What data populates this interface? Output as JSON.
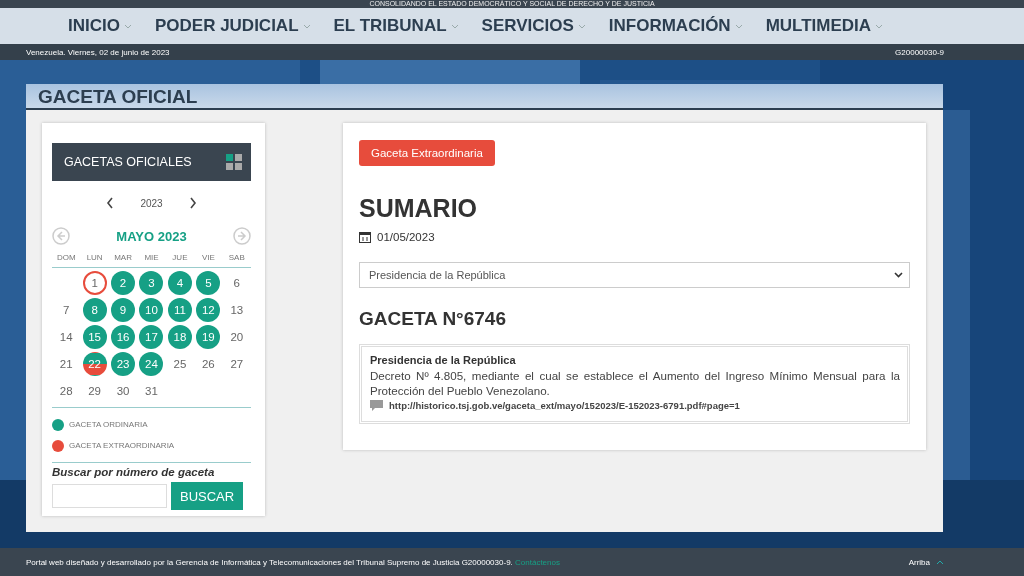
{
  "banner": {
    "text": "CONSOLIDANDO EL ESTADO DEMOCRÁTICO Y SOCIAL DE DERECHO Y DE JUSTICIA"
  },
  "nav": [
    {
      "label": "INICIO"
    },
    {
      "label": "PODER JUDICIAL"
    },
    {
      "label": "EL TRIBUNAL"
    },
    {
      "label": "SERVICIOS"
    },
    {
      "label": "INFORMACIÓN"
    },
    {
      "label": "MULTIMEDIA"
    }
  ],
  "info_bar": {
    "date": "Venezuela. Viernes, 02 de junio de 2023",
    "code": "G20000030-9"
  },
  "page_title": "GACETA OFICIAL",
  "sidebar": {
    "title": "GACETAS OFICIALES",
    "year": "2023",
    "month": "MAYO 2023",
    "weekdays": [
      "DOM",
      "LUN",
      "MAR",
      "MIE",
      "JUE",
      "VIE",
      "SAB"
    ],
    "days": [
      {
        "kind": "blank"
      },
      {
        "label": "1",
        "kind": "plain",
        "selected": true
      },
      {
        "label": "2",
        "kind": "ordinaria",
        "selected": false
      },
      {
        "label": "3",
        "kind": "ordinaria",
        "selected": false
      },
      {
        "label": "4",
        "kind": "ordinaria",
        "selected": false
      },
      {
        "label": "5",
        "kind": "ordinaria",
        "selected": false
      },
      {
        "label": "6",
        "kind": "plain",
        "selected": false
      },
      {
        "label": "7",
        "kind": "plain",
        "selected": false
      },
      {
        "label": "8",
        "kind": "ordinaria",
        "selected": false
      },
      {
        "label": "9",
        "kind": "ordinaria",
        "selected": false
      },
      {
        "label": "10",
        "kind": "ordinaria",
        "selected": false
      },
      {
        "label": "11",
        "kind": "ordinaria",
        "selected": false
      },
      {
        "label": "12",
        "kind": "ordinaria",
        "selected": false
      },
      {
        "label": "13",
        "kind": "plain",
        "selected": false
      },
      {
        "label": "14",
        "kind": "plain",
        "selected": false
      },
      {
        "label": "15",
        "kind": "ordinaria",
        "selected": false
      },
      {
        "label": "16",
        "kind": "ordinaria",
        "selected": false
      },
      {
        "label": "17",
        "kind": "ordinaria",
        "selected": false
      },
      {
        "label": "18",
        "kind": "ordinaria",
        "selected": false
      },
      {
        "label": "19",
        "kind": "ordinaria",
        "selected": false
      },
      {
        "label": "20",
        "kind": "plain",
        "selected": false
      },
      {
        "label": "21",
        "kind": "plain",
        "selected": false
      },
      {
        "label": "22",
        "kind": "mixta",
        "selected": false
      },
      {
        "label": "23",
        "kind": "ordinaria",
        "selected": false
      },
      {
        "label": "24",
        "kind": "ordinaria",
        "selected": false
      },
      {
        "label": "25",
        "kind": "plain",
        "selected": false
      },
      {
        "label": "26",
        "kind": "plain",
        "selected": false
      },
      {
        "label": "27",
        "kind": "plain",
        "selected": false
      },
      {
        "label": "28",
        "kind": "plain",
        "selected": false
      },
      {
        "label": "29",
        "kind": "plain",
        "selected": false
      },
      {
        "label": "30",
        "kind": "plain",
        "selected": false
      },
      {
        "label": "31",
        "kind": "plain",
        "selected": false
      }
    ],
    "legend": [
      {
        "label": "GACETA ORDINARIA",
        "color": "#16a085"
      },
      {
        "label": "GACETA EXTRAORDINARIA",
        "color": "#e74c3c"
      }
    ],
    "search_label": "Buscar por número de gaceta",
    "search_button": "BUSCAR"
  },
  "content": {
    "badge": "Gaceta Extraordinaria",
    "heading": "SUMARIO",
    "date": "01/05/2023",
    "select_value": "Presidencia de la República",
    "gaceta_title": "GACETA N°6746",
    "entry": {
      "organ": "Presidencia de la República",
      "text": "Decreto Nº 4.805, mediante el cual se establece el Aumento del Ingreso Mínimo Mensual para la Protección del Pueblo Venezolano.",
      "link": "http://historico.tsj.gob.ve/gaceta_ext/mayo/152023/E-152023-6791.pdf#page=1"
    }
  },
  "footer": {
    "text": "Portal web diseñado y desarrollado por la Gerencia de Informática y Telecomunicaciones del Tribunal Supremo de Justicia G20000030-9.",
    "link": "Contáctenos",
    "top_link": "Arriba"
  }
}
